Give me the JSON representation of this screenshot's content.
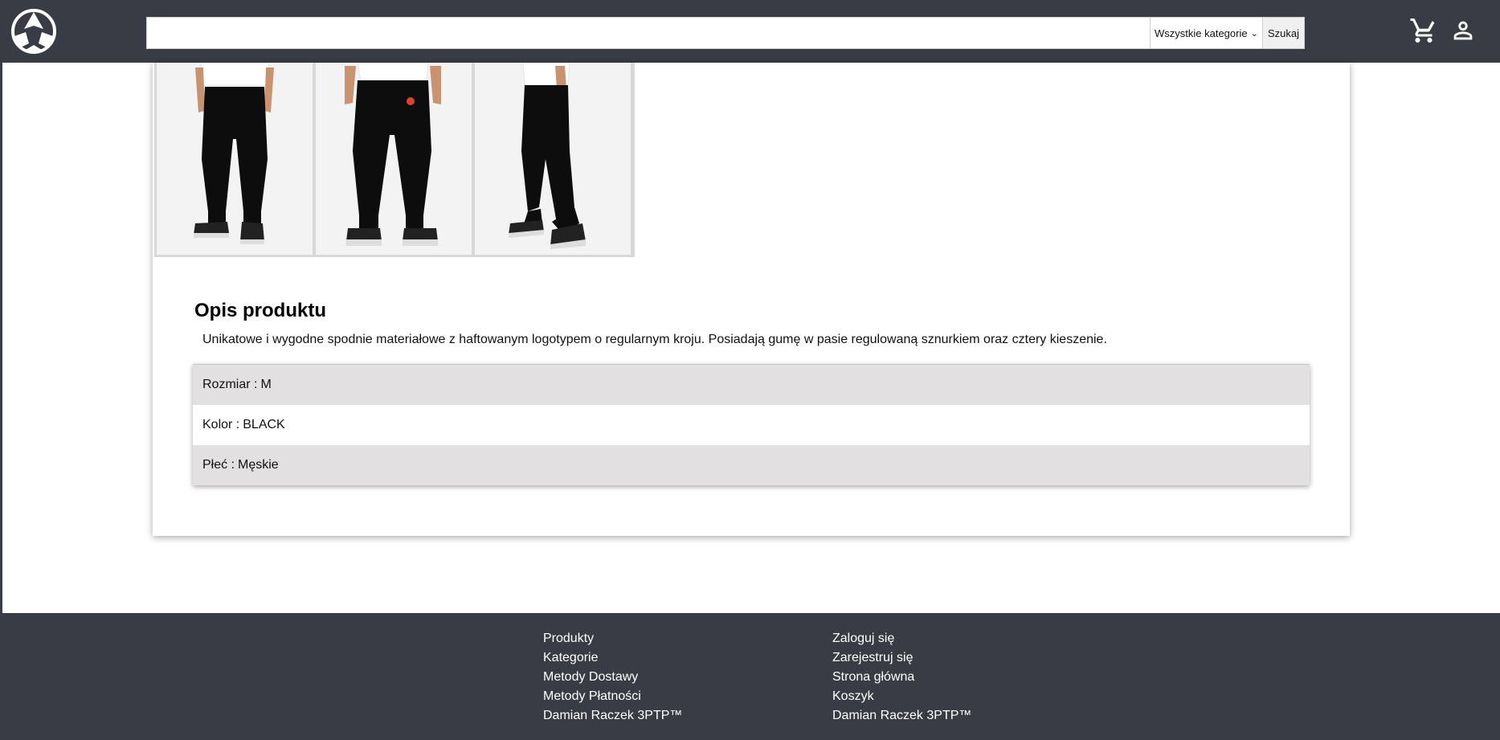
{
  "header": {
    "search": {
      "value": "",
      "placeholder": ""
    },
    "category_select": {
      "selected": "Wszystkie kategorie"
    },
    "search_button": "Szukaj"
  },
  "product": {
    "gallery": [
      {
        "alt": "front view"
      },
      {
        "alt": "back view"
      },
      {
        "alt": "side view"
      }
    ],
    "description_title": "Opis produktu",
    "description_text": "Unikatowe i wygodne spodnie materiałowe z haftowanym logotypem o regularnym kroju. Posiadają gumę w pasie regulowaną sznurkiem oraz cztery kieszenie.",
    "attributes": [
      {
        "label": "Rozmiar :",
        "value": "M"
      },
      {
        "label": "Kolor :",
        "value": "BLACK"
      },
      {
        "label": "Płeć :",
        "value": "Męskie"
      }
    ]
  },
  "footer": {
    "left_links": [
      "Produkty",
      "Kategorie",
      "Metody Dostawy",
      "Metody Płatności",
      "Damian Raczek 3PTP™"
    ],
    "right_links": [
      "Zaloguj się",
      "Zarejestruj się",
      "Strona główna",
      "Koszyk",
      "Damian Raczek 3PTP™"
    ]
  },
  "colors": {
    "header_bg": "#393c44",
    "footer_bg": "#393c44",
    "row_shade": "#e2e0e0"
  }
}
